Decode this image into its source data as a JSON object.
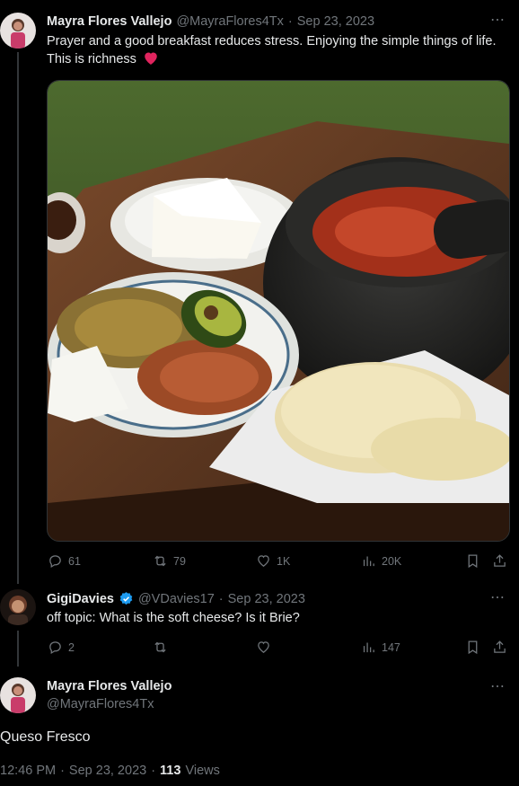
{
  "tweet1": {
    "name": "Mayra Flores Vallejo",
    "handle": "@MayraFlores4Tx",
    "date": "Sep 23, 2023",
    "text": "Prayer and a good breakfast reduces stress. Enjoying the simple things of life. This is richness",
    "emoji": "red-heart",
    "replies": "61",
    "reposts": "79",
    "likes": "1K",
    "views": "20K"
  },
  "tweet2": {
    "name": "GigiDavies",
    "verified": true,
    "handle": "@VDavies17",
    "date": "Sep 23, 2023",
    "text": "off topic: What is the soft cheese? Is it Brie?",
    "replies": "2",
    "reposts": "",
    "likes": "",
    "views": "147"
  },
  "tweet3": {
    "name": "Mayra Flores Vallejo",
    "handle": "@MayraFlores4Tx",
    "text": "Queso Fresco",
    "time": "12:46 PM",
    "date": "Sep 23, 2023",
    "views_count": "113",
    "views_label": "Views"
  },
  "colors": {
    "background": "#000000",
    "text": "#e7e9ea",
    "muted": "#71767b",
    "heart": "#f91880",
    "verified": "#1d9bf0"
  },
  "separator": "·",
  "more_icon": "⋯"
}
